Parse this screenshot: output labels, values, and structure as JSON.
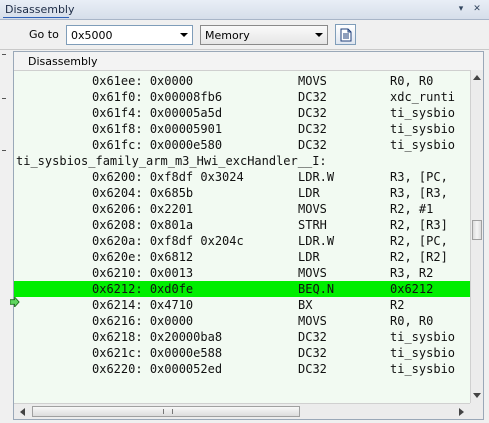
{
  "window": {
    "title": "Disassembly"
  },
  "toolbar": {
    "goto_label": "Go to",
    "address_value": "0x5000",
    "view_mode": "Memory",
    "toolbar_button_icon": "document-icon"
  },
  "pane": {
    "header": "Disassembly",
    "current_row_color": "#00ee00",
    "background_color": "#f2faf2"
  },
  "rows": [
    {
      "type": "instr",
      "addr": "0x61ee:",
      "code": "0x0000",
      "op": "MOVS",
      "args": "R0, R0"
    },
    {
      "type": "instr",
      "addr": "0x61f0:",
      "code": "0x00008fb6",
      "op": "DC32",
      "args": "xdc_runti"
    },
    {
      "type": "instr",
      "addr": "0x61f4:",
      "code": "0x00005a5d",
      "op": "DC32",
      "args": "ti_sysbio"
    },
    {
      "type": "instr",
      "addr": "0x61f8:",
      "code": "0x00005901",
      "op": "DC32",
      "args": "ti_sysbio"
    },
    {
      "type": "instr",
      "addr": "0x61fc:",
      "code": "0x0000e580",
      "op": "DC32",
      "args": "ti_sysbio"
    },
    {
      "type": "label",
      "text": "ti_sysbios_family_arm_m3_Hwi_excHandler__I:"
    },
    {
      "type": "instr",
      "addr": "0x6200:",
      "code": "0xf8df 0x3024",
      "op": "LDR.W",
      "args": "R3, [PC,"
    },
    {
      "type": "instr",
      "addr": "0x6204:",
      "code": "0x685b",
      "op": "LDR",
      "args": "R3, [R3,"
    },
    {
      "type": "instr",
      "addr": "0x6206:",
      "code": "0x2201",
      "op": "MOVS",
      "args": "R2, #1"
    },
    {
      "type": "instr",
      "addr": "0x6208:",
      "code": "0x801a",
      "op": "STRH",
      "args": "R2, [R3]"
    },
    {
      "type": "instr",
      "addr": "0x620a:",
      "code": "0xf8df 0x204c",
      "op": "LDR.W",
      "args": "R2, [PC,"
    },
    {
      "type": "instr",
      "addr": "0x620e:",
      "code": "0x6812",
      "op": "LDR",
      "args": "R2, [R2]"
    },
    {
      "type": "instr",
      "addr": "0x6210:",
      "code": "0x0013",
      "op": "MOVS",
      "args": "R3, R2"
    },
    {
      "type": "instr",
      "addr": "0x6212:",
      "code": "0xd0fe",
      "op": "BEQ.N",
      "args": "0x6212",
      "current": true
    },
    {
      "type": "instr",
      "addr": "0x6214:",
      "code": "0x4710",
      "op": "BX",
      "args": "R2"
    },
    {
      "type": "instr",
      "addr": "0x6216:",
      "code": "0x0000",
      "op": "MOVS",
      "args": "R0, R0"
    },
    {
      "type": "instr",
      "addr": "0x6218:",
      "code": "0x20000ba8",
      "op": "DC32",
      "args": "ti_sysbio"
    },
    {
      "type": "instr",
      "addr": "0x621c:",
      "code": "0x0000e588",
      "op": "DC32",
      "args": "ti_sysbio"
    },
    {
      "type": "instr",
      "addr": "0x6220:",
      "code": "0x000052ed",
      "op": "DC32",
      "args": "ti_sysbio"
    }
  ]
}
